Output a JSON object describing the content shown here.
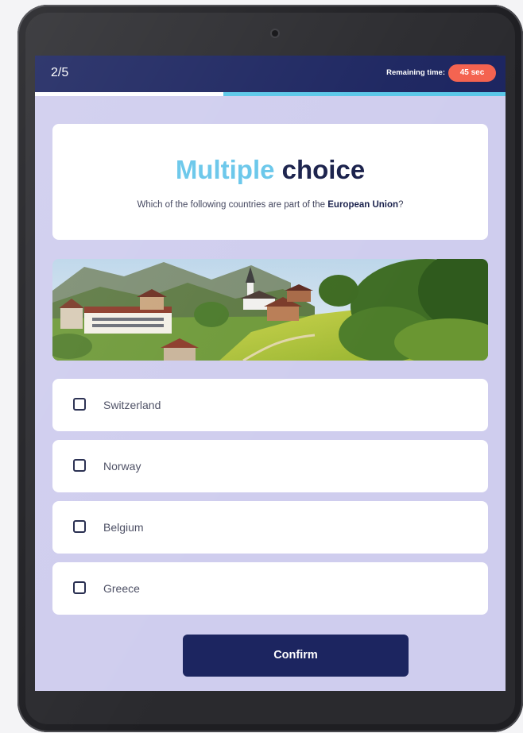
{
  "header": {
    "question_counter": "2/5",
    "remaining_time_label": "Remaining time:",
    "remaining_time_value": "45 sec"
  },
  "progress": {
    "fraction": 0.4
  },
  "question": {
    "title_accent": "Multiple",
    "title_rest": "choice",
    "prompt_prefix": "Which of the following countries are part of the",
    "prompt_bold": "European Union",
    "prompt_suffix": "?"
  },
  "options": [
    {
      "label": "Switzerland",
      "checked": false
    },
    {
      "label": "Norway",
      "checked": false
    },
    {
      "label": "Belgium",
      "checked": false
    },
    {
      "label": "Greece",
      "checked": false
    }
  ],
  "confirm_label": "Confirm",
  "colors": {
    "brand_navy": "#1c2560",
    "accent_cyan": "#67c6ea",
    "timer_red": "#f4624f",
    "screen_background": "#cfcdee"
  },
  "icons": [
    "checkbox-icon",
    "camera-icon"
  ]
}
